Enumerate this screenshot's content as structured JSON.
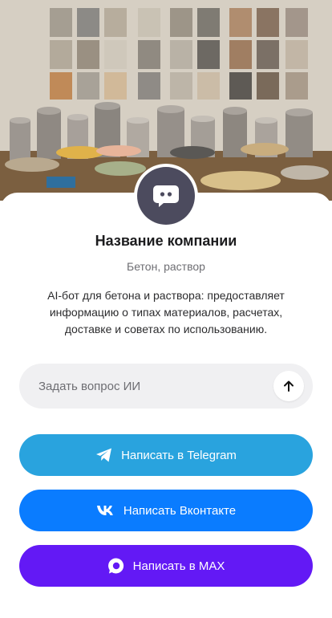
{
  "company": {
    "name": "Название компании",
    "category": "Бетон, раствор",
    "description": "AI-бот для бетона и раствора: предоставляет информацию о типах материалов, расчетах, доставке и советах по использованию."
  },
  "ask": {
    "placeholder": "Задать вопрос ИИ"
  },
  "buttons": {
    "telegram": "Написать в Telegram",
    "vk": "Написать Вконтакте",
    "max": "Написать в MAX"
  },
  "colors": {
    "telegram": "#29a3de",
    "vk": "#0a7cff",
    "max": "#6319f5",
    "avatar": "#4c4b5e"
  },
  "icons": {
    "avatar": "chat-bot-icon",
    "send": "arrow-up-icon",
    "telegram": "telegram-icon",
    "vk": "vk-icon",
    "max": "max-icon"
  }
}
